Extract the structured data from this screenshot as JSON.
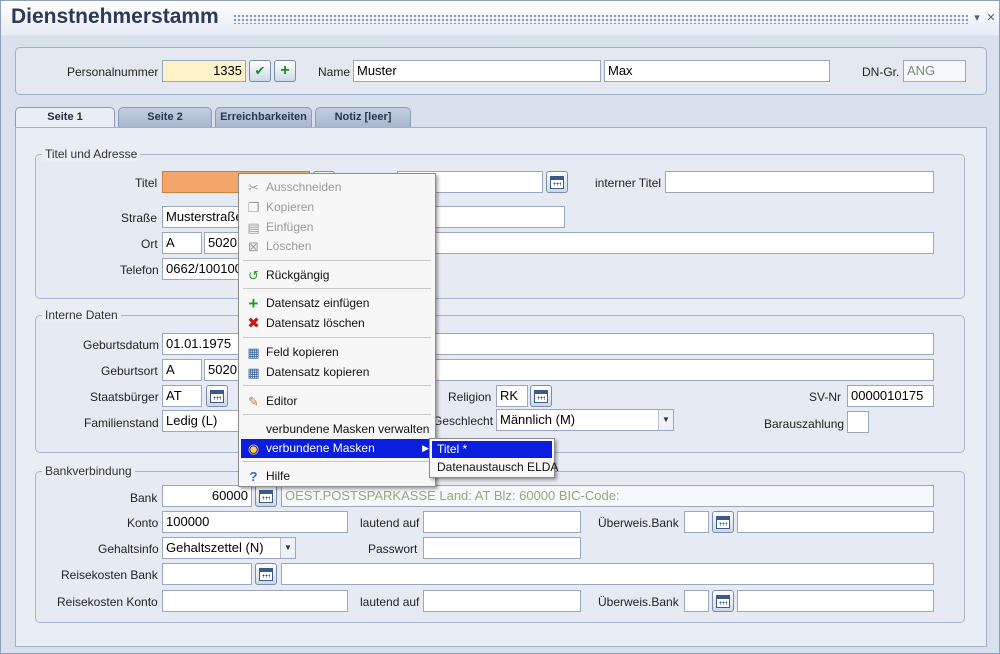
{
  "window": {
    "title": "Dienstnehmerstamm",
    "controls": [
      "minimize-icon",
      "close-icon"
    ]
  },
  "header": {
    "personalnummer_label": "Personalnummer",
    "personalnummer_value": "1335",
    "name_label": "Name",
    "last_name": "Muster",
    "first_name": "Max",
    "dn_gr_label": "DN-Gr.",
    "dn_gr_value": "ANG",
    "icons": [
      "check-icon",
      "add-icon"
    ]
  },
  "tabs": [
    {
      "label": "Seite 1",
      "active": true
    },
    {
      "label": "Seite 2",
      "active": false
    },
    {
      "label": "Erreichbarkeiten",
      "active": false
    },
    {
      "label": "Notiz [leer]",
      "active": false
    }
  ],
  "titel_adresse": {
    "group_title": "Titel und Adresse",
    "titel_label": "Titel",
    "titel_value": "",
    "interner_titel_label": "interner Titel",
    "interner_titel_value": "",
    "strasse_label": "Straße",
    "strasse_value": "Musterstraße",
    "ort_label": "Ort",
    "ort_country": "A",
    "ort_plz": "5020",
    "telefon_label": "Telefon",
    "telefon_value": "0662/100100"
  },
  "interne_daten": {
    "group_title": "Interne Daten",
    "geburtsdatum_label": "Geburtsdatum",
    "geburtsdatum_value": "01.01.1975",
    "geburtsort_label": "Geburtsort",
    "geburtsort_country": "A",
    "geburtsort_plz": "5020",
    "staatsbuerger_label": "Staatsbürger",
    "staatsbuerger_value": "AT",
    "religion_label": "Religion",
    "religion_value": "RK",
    "sv_nr_label": "SV-Nr",
    "sv_nr_value": "0000010175",
    "familienstand_label": "Familienstand",
    "familienstand_value": "Ledig (L)",
    "geschlecht_label": "Geschlecht",
    "geschlecht_value": "Männlich (M)",
    "barauszahlung_label": "Barauszahlung"
  },
  "bank": {
    "group_title": "Bankverbindung",
    "bank_label": "Bank",
    "bank_code": "60000",
    "bank_description": "OEST.POSTSPARKASSE Land: AT Blz: 60000 BIC-Code:",
    "konto_label": "Konto",
    "konto_value": "100000",
    "lautend_auf_label": "lautend auf",
    "ueberweis_bank_label": "Überweis.Bank",
    "gehaltsinfo_label": "Gehaltsinfo",
    "gehaltsinfo_value": "Gehaltszettel (N)",
    "passwort_label": "Passwort",
    "reisekosten_bank_label": "Reisekosten Bank",
    "reisekosten_konto_label": "Reisekosten Konto",
    "lautend_auf2_label": "lautend auf",
    "ueberweis_bank2_label": "Überweis.Bank"
  },
  "context_menu": {
    "items": [
      {
        "label": "Ausschneiden",
        "icon": "scissors-icon",
        "enabled": false
      },
      {
        "label": "Kopieren",
        "icon": "copy-icon",
        "enabled": false
      },
      {
        "label": "Einfügen",
        "icon": "paste-icon",
        "enabled": false
      },
      {
        "label": "Löschen",
        "icon": "delete-icon",
        "enabled": false
      },
      {
        "label": "Rückgängig",
        "icon": "undo-icon",
        "enabled": true
      },
      {
        "label": "Datensatz einfügen",
        "icon": "plus-icon",
        "enabled": true
      },
      {
        "label": "Datensatz löschen",
        "icon": "x-icon",
        "enabled": true
      },
      {
        "label": "Feld kopieren",
        "icon": "grid-icon",
        "enabled": true
      },
      {
        "label": "Datensatz kopieren",
        "icon": "grid-icon",
        "enabled": true
      },
      {
        "label": "Editor",
        "icon": "pencil-icon",
        "enabled": true
      },
      {
        "label": "verbundene Masken verwalten",
        "icon": "",
        "enabled": true
      },
      {
        "label": "verbundene Masken",
        "icon": "link-icon",
        "enabled": true,
        "highlighted": true
      },
      {
        "label": "Hilfe",
        "icon": "help-icon",
        "enabled": true
      }
    ],
    "submenu": [
      {
        "label": "Titel *",
        "highlighted": true
      },
      {
        "label": "Datenaustausch ELDA",
        "highlighted": false
      }
    ]
  },
  "colors": {
    "menu_highlight": "#0a1ee0",
    "title_text": "#2b3b57",
    "focus_field": "#f3a66a",
    "key_field": "#fdf2c8"
  }
}
